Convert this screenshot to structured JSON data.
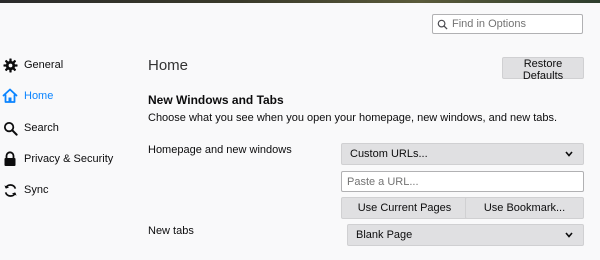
{
  "search": {
    "placeholder": "Find in Options"
  },
  "sidebar": {
    "items": [
      {
        "label": "General",
        "icon": "gear-icon",
        "active": false
      },
      {
        "label": "Home",
        "icon": "home-icon",
        "active": true
      },
      {
        "label": "Search",
        "icon": "search-icon",
        "active": false
      },
      {
        "label": "Privacy & Security",
        "icon": "lock-icon",
        "active": false
      },
      {
        "label": "Sync",
        "icon": "sync-icon",
        "active": false
      }
    ]
  },
  "main": {
    "title": "Home",
    "restore_label": "Restore Defaults",
    "section_title": "New Windows and Tabs",
    "section_desc": "Choose what you see when you open your homepage, new windows, and new tabs.",
    "homepage_label": "Homepage and new windows",
    "homepage_select": "Custom URLs...",
    "url_placeholder": "Paste a URL...",
    "use_current_label": "Use Current Pages",
    "use_bookmark_label": "Use Bookmark...",
    "newtabs_label": "New tabs",
    "newtabs_select": "Blank Page"
  },
  "colors": {
    "accent": "#0a84ff",
    "background": "#f9f9fa",
    "button": "#e0e0e2"
  }
}
